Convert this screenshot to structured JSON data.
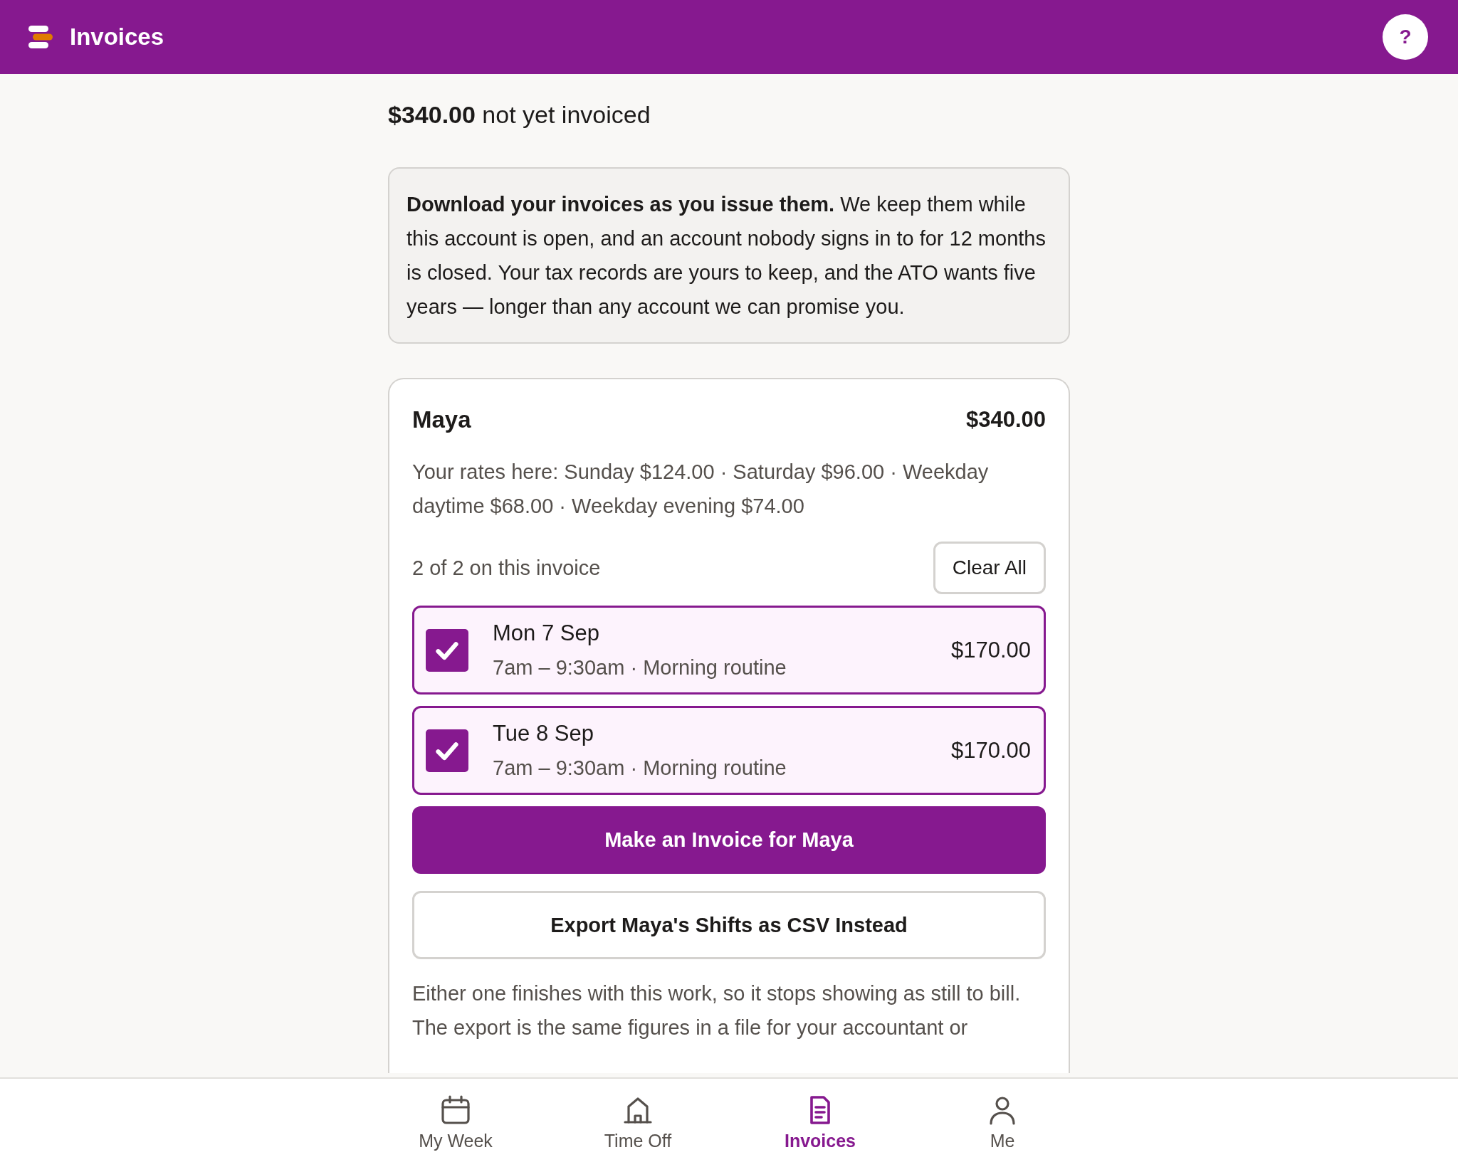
{
  "header": {
    "title": "Invoices",
    "help": "?"
  },
  "summary": "**$340.00** not yet invoiced",
  "notice": "**Download your invoices as you issue them.** We keep them while this account is open, and an account nobody signs in to for 12 months is closed. Your tax records are yours to keep, and the ATO wants five years — longer than any account we can promise you.",
  "client": {
    "name": "Maya",
    "total": "$340.00",
    "rates": "Your rates here: Sunday $124.00 · Saturday $96.00 · Weekday daytime $68.00 · Weekday evening $74.00",
    "count": "2 of 2 on this invoice",
    "clear_button": "Clear All",
    "shifts": [
      {
        "date": "Mon 7 Sep",
        "detail": "7am – 9:30am · Morning routine",
        "amount": "$170.00",
        "checked": true
      },
      {
        "date": "Tue 8 Sep",
        "detail": "7am – 9:30am · Morning routine",
        "amount": "$170.00",
        "checked": true
      }
    ],
    "invoice_button": "Make an Invoice for Maya",
    "export_button": "Export Maya's Shifts as CSV Instead",
    "footnote": "Either one finishes with this work, so it stops showing as still to bill. The export is the same figures in a file for your accountant or"
  },
  "nav": [
    {
      "label": "My Week",
      "kind": "calendar",
      "selected": false
    },
    {
      "label": "Time Off",
      "kind": "house",
      "selected": false
    },
    {
      "label": "Invoices",
      "kind": "document",
      "selected": true
    },
    {
      "label": "Me",
      "kind": "person",
      "selected": false
    }
  ]
}
